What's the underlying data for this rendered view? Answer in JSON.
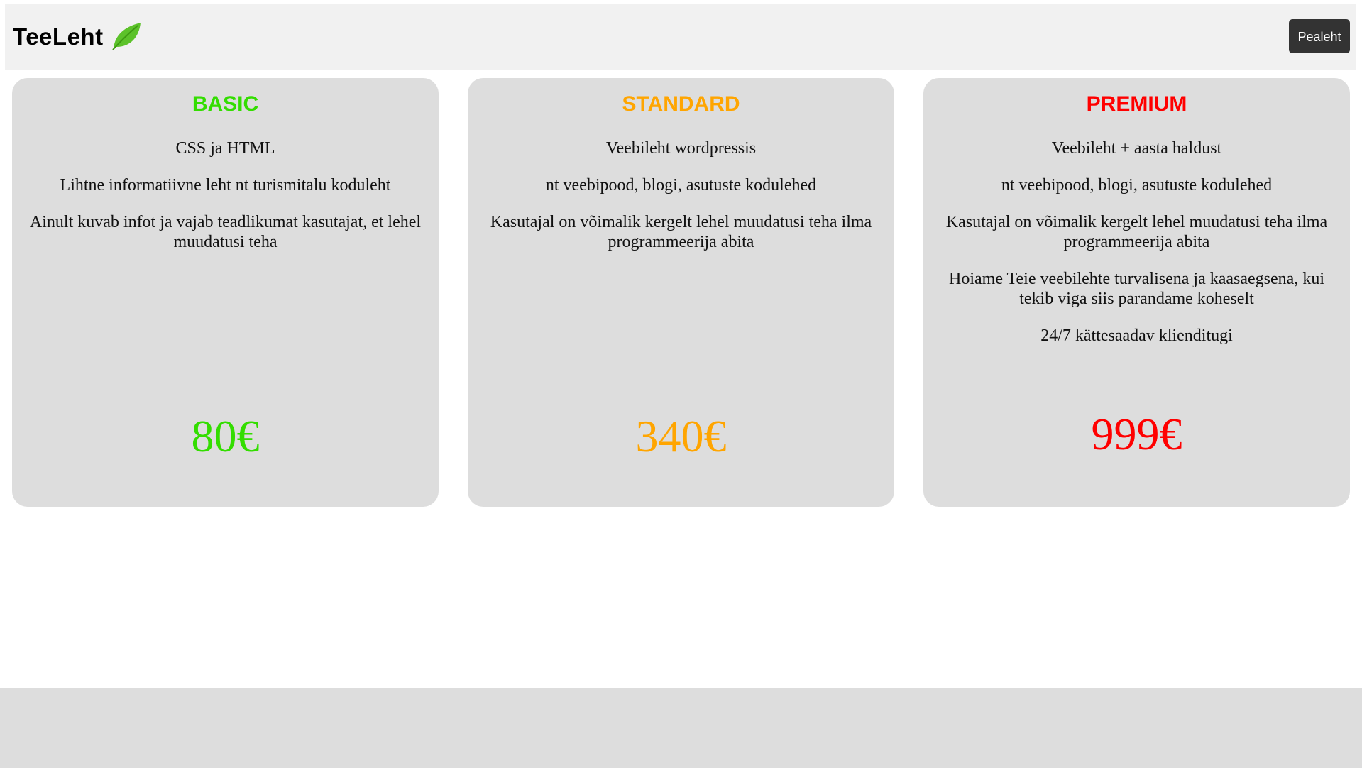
{
  "header": {
    "brand": "TeeLeht",
    "nav_button": "Pealeht"
  },
  "plans": [
    {
      "name": "BASIC",
      "color": "#33dd00",
      "features": [
        "CSS ja HTML",
        "Lihtne informatiivne leht nt turismitalu koduleht",
        "Ainult kuvab infot ja vajab teadlikumat kasutajat, et lehel muudatusi teha"
      ],
      "price": "80€"
    },
    {
      "name": "STANDARD",
      "color": "#ffa500",
      "features": [
        "Veebileht wordpressis",
        "nt veebipood, blogi, asutuste kodulehed",
        "Kasutajal on võimalik kergelt lehel muudatusi teha ilma programmeerija abita"
      ],
      "price": "340€"
    },
    {
      "name": "PREMIUM",
      "color": "#ff0000",
      "features": [
        "Veebileht + aasta haldust",
        "nt veebipood, blogi, asutuste kodulehed",
        "Kasutajal on võimalik kergelt lehel muudatusi teha ilma programmeerija abita",
        "Hoiame Teie veebilehte turvalisena ja kaasaegsena, kui tekib viga siis parandame koheselt",
        "24/7 kättesaadav klienditugi"
      ],
      "price": "999€"
    }
  ]
}
